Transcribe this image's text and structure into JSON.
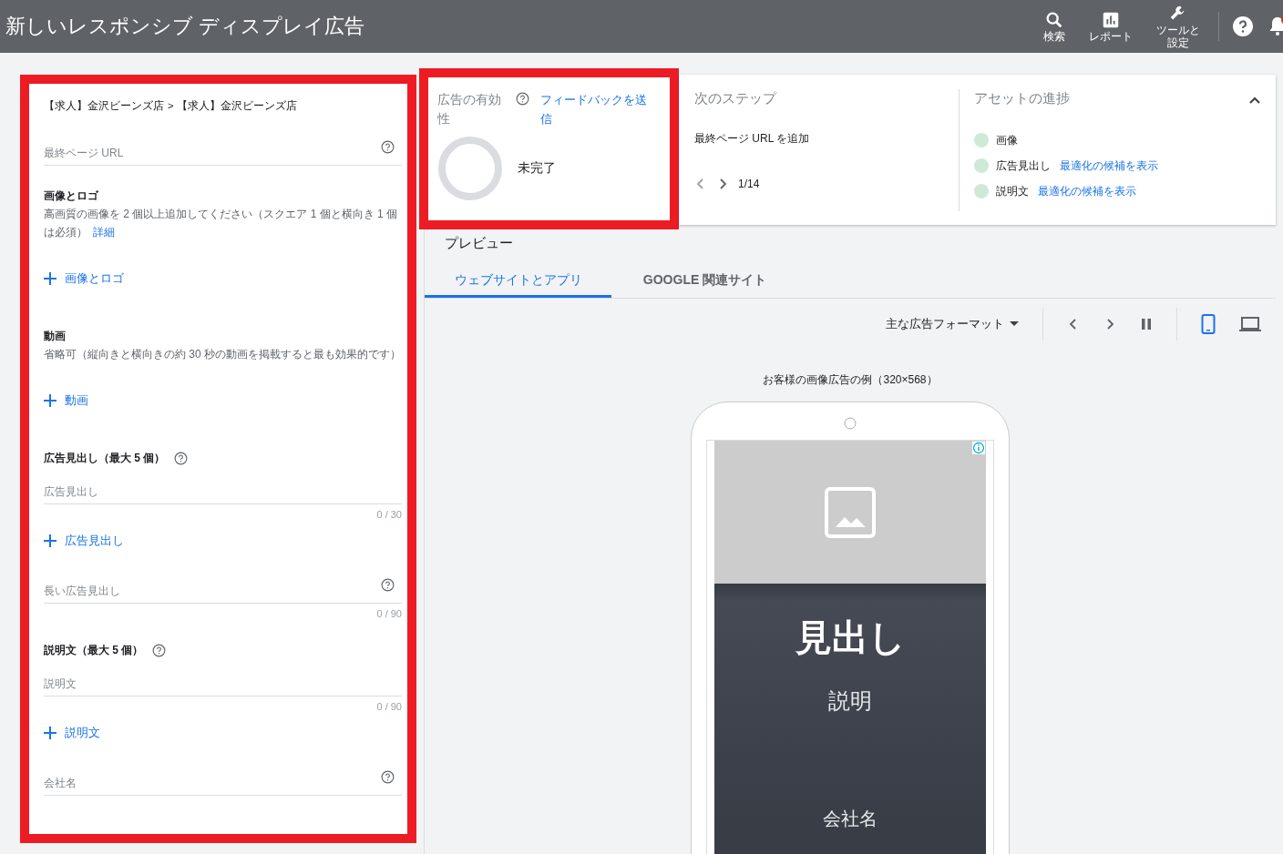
{
  "header": {
    "title": "新しいレスポンシブ ディスプレイ広告",
    "actions": [
      {
        "kind": "search",
        "lines": [
          "検索"
        ]
      },
      {
        "kind": "report",
        "lines": [
          "レポート"
        ]
      },
      {
        "kind": "tools",
        "lines": [
          "ツールと",
          "設定"
        ]
      }
    ],
    "notifications": {
      "badge": true
    }
  },
  "editor": {
    "breadcrumb": [
      "【求人】金沢ビーンズ店",
      ">",
      "【求人】金沢ビーンズ店"
    ],
    "items": [
      {
        "kind": "field",
        "placeholder": "最終ページ URL",
        "help": true
      },
      {
        "kind": "heading",
        "title": "画像とロゴ",
        "description": "高画質の画像を 2 個以上追加してください（スクエア 1 個と横向き 1 個は必須）",
        "link": "詳細"
      },
      {
        "kind": "add",
        "label": "画像とロゴ"
      },
      {
        "kind": "heading",
        "title": "動画",
        "description": "省略可（縦向きと横向きの約 30 秒の動画を掲載すると最も効果的です）"
      },
      {
        "kind": "add",
        "label": "動画"
      },
      {
        "kind": "heading",
        "title": "広告見出し（最大 5 個）",
        "help": true
      },
      {
        "kind": "field",
        "placeholder": "広告見出し",
        "help": false,
        "counter": "0 / 30"
      },
      {
        "kind": "add",
        "label": "広告見出し"
      },
      {
        "kind": "field",
        "placeholder": "長い広告見出し",
        "help": true,
        "counter": "0 / 90"
      },
      {
        "kind": "heading",
        "title": "説明文（最大 5 個）",
        "help": true
      },
      {
        "kind": "field",
        "placeholder": "説明文",
        "help": false,
        "counter": "0 / 90"
      },
      {
        "kind": "add",
        "label": "説明文"
      },
      {
        "kind": "field",
        "placeholder": "会社名",
        "help": true
      }
    ]
  },
  "effectiveness": {
    "title": "広告の有効性",
    "feedback_link": "フィードバックを送信",
    "status": "未完了"
  },
  "next_steps": {
    "title": "次のステップ",
    "step": "最終ページ URL を追加",
    "pager": "1/14"
  },
  "asset_progress": {
    "title": "アセットの進捗",
    "items": [
      {
        "label": "画像"
      },
      {
        "label": "広告見出し",
        "link": "最適化の候補を表示"
      },
      {
        "label": "説明文",
        "link": "最適化の候補を表示"
      }
    ]
  },
  "preview": {
    "title": "プレビュー",
    "tabs": [
      {
        "label": "ウェブサイトとアプリ",
        "selected": true
      },
      {
        "label": "GOOGLE 関連サイト",
        "selected": false
      }
    ],
    "format_dropdown": "主な広告フォーマット",
    "devices": [
      {
        "kind": "mobile",
        "selected": true
      },
      {
        "kind": "desktop",
        "selected": false
      }
    ],
    "caption": "お客様の画像広告の例（320×568）",
    "ad": {
      "headline": "見出し",
      "description": "説明",
      "company": "会社名"
    }
  }
}
